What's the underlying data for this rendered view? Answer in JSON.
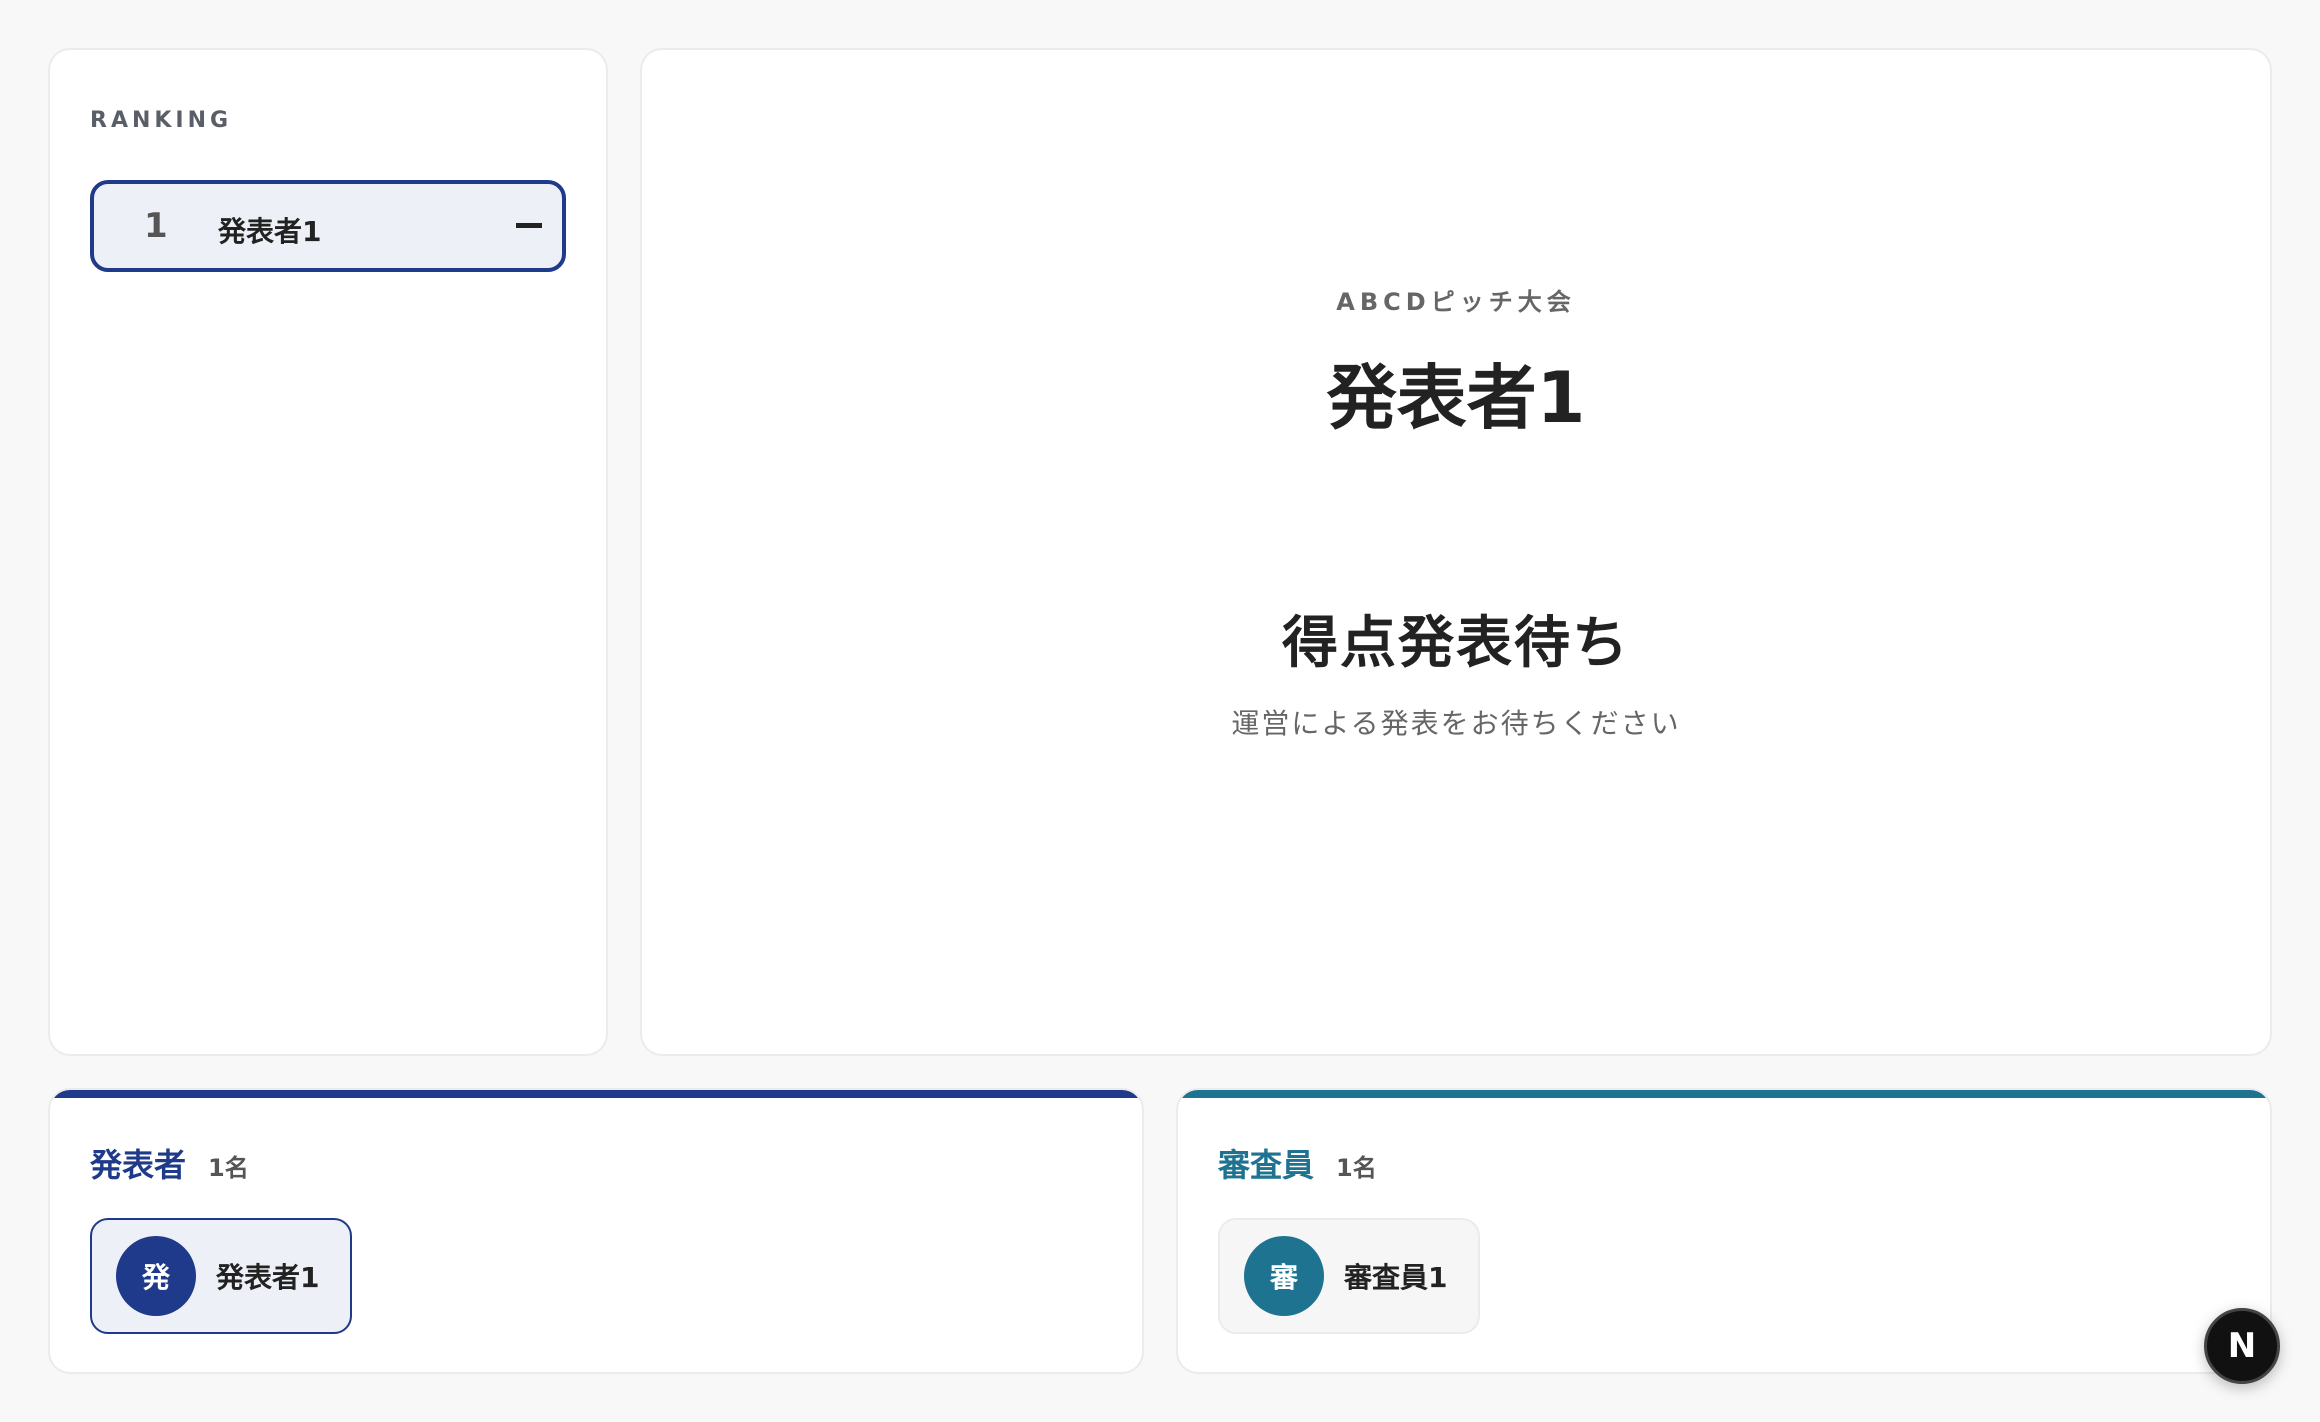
{
  "ranking": {
    "label": "RANKING",
    "items": [
      {
        "rank": "1",
        "name": "発表者1",
        "score": "—"
      }
    ]
  },
  "stage": {
    "event_name": "ABCDピッチ大会",
    "presenter_name": "発表者1",
    "status": "得点発表待ち",
    "status_sub": "運営による発表をお待ちください"
  },
  "presenters": {
    "title": "発表者",
    "count": "1名",
    "members": [
      {
        "initial": "発",
        "name": "発表者1"
      }
    ]
  },
  "judges": {
    "title": "審査員",
    "count": "1名",
    "members": [
      {
        "initial": "審",
        "name": "審査員1"
      }
    ]
  },
  "badge": {
    "letter": "N"
  },
  "colors": {
    "presenter_accent": "#1f3a8a",
    "judge_accent": "#1e7390"
  }
}
